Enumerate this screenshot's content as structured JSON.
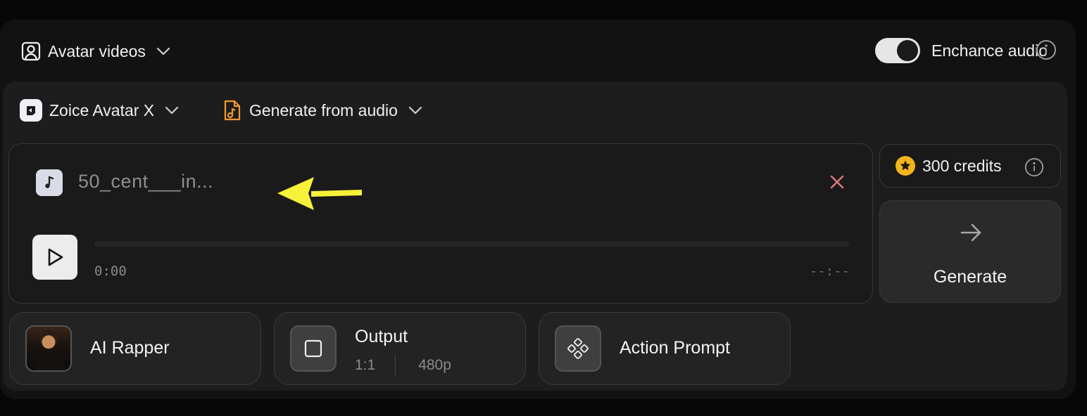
{
  "topbar": {
    "mode_label": "Avatar videos",
    "enhance_label": "Enchance audio",
    "enhance_on": true
  },
  "selectors": {
    "model_label": "Zoice Avatar X",
    "source_label": "Generate from audio"
  },
  "audio": {
    "filename": "50_cent___in...",
    "time_current": "0:00",
    "time_total": "--:--",
    "progress": 0
  },
  "credits": {
    "amount_label": "300 credits"
  },
  "generate": {
    "label": "Generate"
  },
  "chips": {
    "avatar_label": "AI Rapper",
    "output_label": "Output",
    "output_ratio": "1:1",
    "output_resolution": "480p",
    "action_label": "Action Prompt"
  },
  "colors": {
    "accent_orange": "#f29a2e",
    "coin_yellow": "#f2b51c",
    "close_red": "#e07a7a",
    "annotation_yellow": "#f7f13a"
  }
}
